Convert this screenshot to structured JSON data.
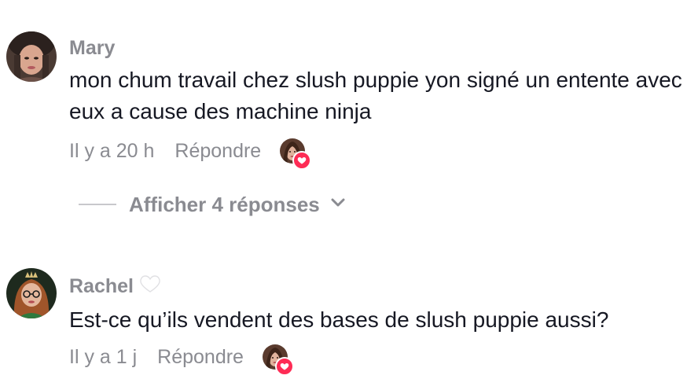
{
  "comments": [
    {
      "username": "Mary",
      "text": "mon chum travail chez slush puppie yon signé un entente avec eux a cause des machine ninja",
      "time": "Il y a 20 h",
      "reply_label": "Répondre",
      "liked_by_creator": true,
      "replies_label": "Afficher 4 réponses"
    },
    {
      "username": "Rachel",
      "username_badge": "🤍",
      "text": "Est-ce qu’ils vendent des bases de slush puppie aussi?",
      "time": "Il y a 1 j",
      "reply_label": "Répondre",
      "liked_by_creator": true
    }
  ],
  "icons": {
    "like_badge": "heart-icon",
    "expand": "chevron-down-icon"
  },
  "colors": {
    "secondary_text": "#8a8b91",
    "primary_text": "#161823",
    "like_badge": "#fe2c55"
  }
}
